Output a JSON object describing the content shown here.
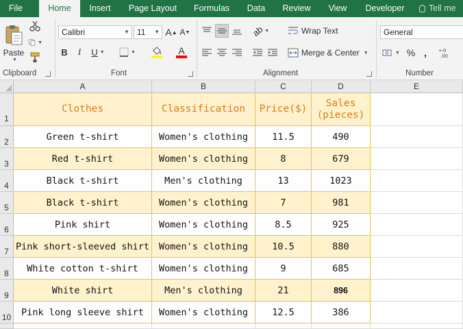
{
  "menu": {
    "tabs": [
      {
        "label": "File",
        "active": false
      },
      {
        "label": "Home",
        "active": true
      },
      {
        "label": "Insert",
        "active": false
      },
      {
        "label": "Page Layout",
        "active": false
      },
      {
        "label": "Formulas",
        "active": false
      },
      {
        "label": "Data",
        "active": false
      },
      {
        "label": "Review",
        "active": false
      },
      {
        "label": "View",
        "active": false
      },
      {
        "label": "Developer",
        "active": false
      }
    ],
    "tell_me": "Tell me"
  },
  "ribbon": {
    "clipboard": {
      "label": "Clipboard",
      "paste_label": "Paste"
    },
    "font": {
      "label": "Font",
      "name": "Calibri",
      "size": "11",
      "bold": "B",
      "italic": "I",
      "underline": "U",
      "grow": "A",
      "shrink": "A",
      "font_color_letter": "A"
    },
    "alignment": {
      "label": "Alignment",
      "wrap_text": "Wrap Text",
      "merge_center": "Merge & Center"
    },
    "number": {
      "label": "Number",
      "format": "General",
      "percent": "%",
      "comma": ","
    }
  },
  "colors": {
    "accent": "#217346",
    "header_text": "#e07b1c",
    "band_fill": "#fff2cc",
    "border": "#e6c25a"
  },
  "sheet": {
    "columns": [
      "A",
      "B",
      "C",
      "D",
      "E"
    ],
    "rows": [
      "1",
      "2",
      "3",
      "4",
      "5",
      "6",
      "7",
      "8",
      "9",
      "10"
    ],
    "header": [
      "Clothes",
      "Classification",
      "Price($)",
      "Sales (pieces)"
    ],
    "data": [
      [
        "Green t-shirt",
        "Women's clothing",
        "11.5",
        "490"
      ],
      [
        "Red t-shirt",
        "Women's clothing",
        "8",
        "679"
      ],
      [
        "Black t-shirt",
        "Men's clothing",
        "13",
        "1023"
      ],
      [
        "Black t-shirt",
        "Women's clothing",
        "7",
        "981"
      ],
      [
        "Pink shirt",
        "Women's clothing",
        "8.5",
        "925"
      ],
      [
        "Pink short-sleeved shirt",
        "Women's clothing",
        "10.5",
        "880"
      ],
      [
        "White cotton t-shirt",
        "Women's clothing",
        "9",
        "685"
      ],
      [
        "White shirt",
        "Men's clothing",
        "21",
        "896"
      ],
      [
        "Pink long sleeve shirt",
        "Women's clothing",
        "12.5",
        "386"
      ]
    ]
  }
}
